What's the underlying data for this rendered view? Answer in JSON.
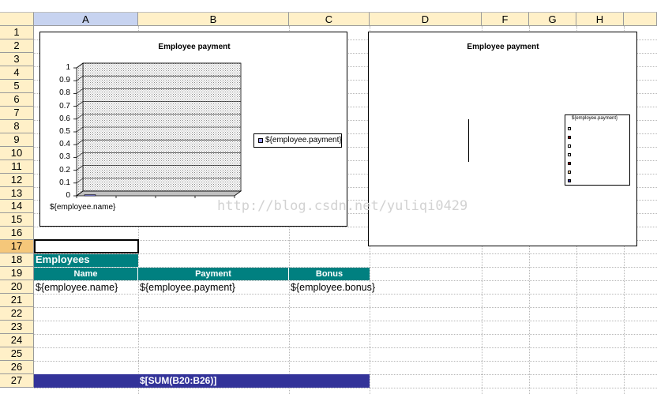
{
  "columns": [
    "A",
    "B",
    "C",
    "D",
    "F",
    "G",
    "H"
  ],
  "rows": [
    "1",
    "2",
    "3",
    "4",
    "5",
    "6",
    "7",
    "8",
    "9",
    "10",
    "11",
    "12",
    "13",
    "14",
    "15",
    "16",
    "17",
    "18",
    "19",
    "20",
    "21",
    "22",
    "23",
    "24",
    "25",
    "26",
    "27"
  ],
  "selected_column": "A",
  "selected_row": "17",
  "chart1": {
    "title": "Employee payment",
    "y_ticks": [
      "1",
      "0.9",
      "0.8",
      "0.7",
      "0.6",
      "0.5",
      "0.4",
      "0.3",
      "0.2",
      "0.1",
      "0"
    ],
    "category_label": "${employee.name}",
    "legend": "${employee.payment}"
  },
  "chart2": {
    "title": "Employee payment",
    "legend": "${employee.payment}"
  },
  "table": {
    "section_title": "Employees",
    "headers": {
      "name": "Name",
      "payment": "Payment",
      "bonus": "Bonus"
    },
    "row": {
      "name": "${employee.name}",
      "payment": "${employee.payment}",
      "bonus": "${employee.bonus}"
    },
    "total_formula": "$[SUM(B20:B26)]"
  },
  "colors": {
    "header_band": "#008080",
    "total_band": "#333399",
    "column_header_bg": "#fff0c8"
  },
  "watermark": "http://blog.csdn.net/yuliqi0429",
  "chart_data": [
    {
      "type": "bar",
      "title": "Employee payment",
      "categories": [
        "${employee.name}"
      ],
      "series": [
        {
          "name": "${employee.payment}",
          "values": [
            0
          ]
        }
      ],
      "ylim": [
        0,
        1
      ],
      "grid": true,
      "legend": "right"
    },
    {
      "type": "pie",
      "title": "Employee payment",
      "categories": [],
      "series": [
        {
          "name": "${employee.payment}",
          "values": []
        }
      ],
      "legend": "right"
    }
  ]
}
